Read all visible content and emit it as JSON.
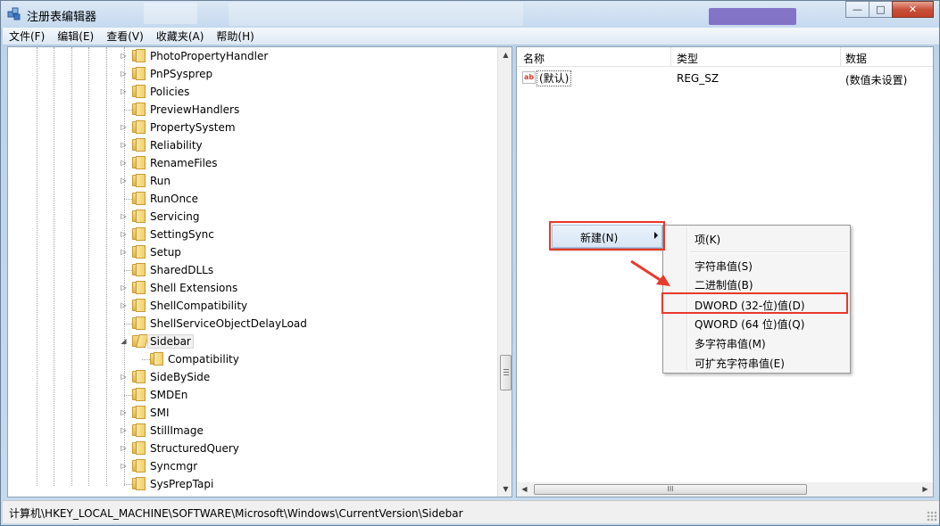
{
  "window": {
    "title": "注册表编辑器",
    "caption_buttons": {
      "minimize": "—",
      "maximize": "□",
      "close": "✕"
    }
  },
  "menu": [
    "文件(F)",
    "编辑(E)",
    "查看(V)",
    "收藏夹(A)",
    "帮助(H)"
  ],
  "tree": {
    "items": [
      {
        "label": "PhotoPropertyHandler",
        "has_children": true
      },
      {
        "label": "PnPSysprep",
        "has_children": true
      },
      {
        "label": "Policies",
        "has_children": true
      },
      {
        "label": "PreviewHandlers",
        "has_children": false
      },
      {
        "label": "PropertySystem",
        "has_children": true
      },
      {
        "label": "Reliability",
        "has_children": true
      },
      {
        "label": "RenameFiles",
        "has_children": true
      },
      {
        "label": "Run",
        "has_children": true
      },
      {
        "label": "RunOnce",
        "has_children": false
      },
      {
        "label": "Servicing",
        "has_children": true
      },
      {
        "label": "SettingSync",
        "has_children": true
      },
      {
        "label": "Setup",
        "has_children": true
      },
      {
        "label": "SharedDLLs",
        "has_children": false
      },
      {
        "label": "Shell Extensions",
        "has_children": true
      },
      {
        "label": "ShellCompatibility",
        "has_children": true
      },
      {
        "label": "ShellServiceObjectDelayLoad",
        "has_children": false
      },
      {
        "label": "Sidebar",
        "has_children": true,
        "expanded": true,
        "selected": true
      },
      {
        "label": "Compatibility",
        "has_children": false,
        "child": true
      },
      {
        "label": "SideBySide",
        "has_children": true
      },
      {
        "label": "SMDEn",
        "has_children": false
      },
      {
        "label": "SMI",
        "has_children": true
      },
      {
        "label": "StillImage",
        "has_children": true
      },
      {
        "label": "StructuredQuery",
        "has_children": true
      },
      {
        "label": "Syncmgr",
        "has_children": true
      },
      {
        "label": "SysPrepTapi",
        "has_children": false
      }
    ]
  },
  "list": {
    "columns": [
      "名称",
      "类型",
      "数据"
    ],
    "rows": [
      {
        "icon": "ab",
        "name": "(默认)",
        "type": "REG_SZ",
        "data": "(数值未设置)"
      }
    ]
  },
  "context_menu": {
    "new_label": "新建(N)",
    "submenu": {
      "key": "项(K)",
      "items": [
        "字符串值(S)",
        "二进制值(B)",
        "DWORD (32-位)值(D)",
        "QWORD (64 位)值(Q)",
        "多字符串值(M)",
        "可扩充字符串值(E)"
      ],
      "highlighted_item": "DWORD (32-位)值(D)"
    }
  },
  "scrollbar": {
    "grip": "III"
  },
  "status_bar": {
    "path": "计算机\\HKEY_LOCAL_MACHINE\\SOFTWARE\\Microsoft\\Windows\\CurrentVersion\\Sidebar"
  },
  "colors": {
    "annotation_red": "#e8392b",
    "title_bar": "#c5d9ee",
    "folder_yellow": "#f1cf6a"
  }
}
